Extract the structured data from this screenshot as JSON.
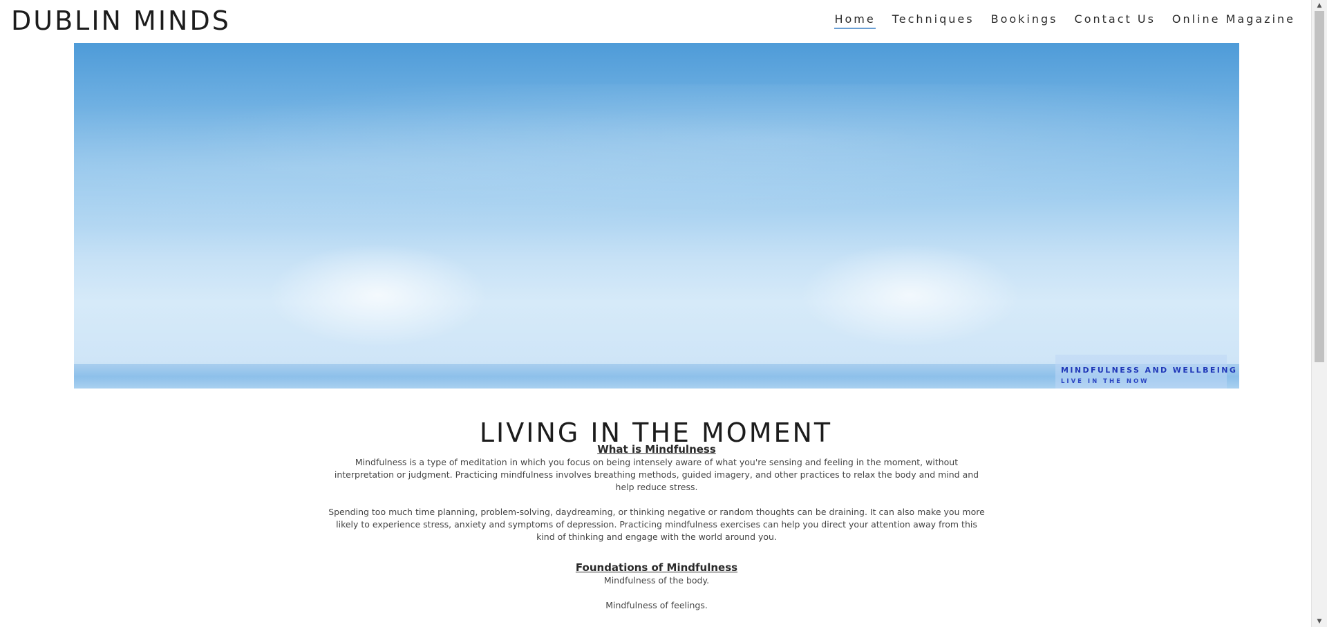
{
  "header": {
    "brand": "DUBLIN MINDS",
    "nav": [
      {
        "label": "Home",
        "active": true
      },
      {
        "label": "Techniques",
        "active": false
      },
      {
        "label": "Bookings",
        "active": false
      },
      {
        "label": "Contact Us",
        "active": false
      },
      {
        "label": "Online Magazine",
        "active": false
      }
    ],
    "active_underline_color": "#6a9fd4"
  },
  "hero": {
    "caption_title": "MINDFULNESS AND WELLBEING",
    "caption_subtitle": "LIVE IN THE NOW",
    "caption_color": "#1f37b8"
  },
  "main": {
    "title": "LIVING IN THE MOMENT",
    "sections": [
      {
        "heading": "What is Mindfulness",
        "paragraphs": [
          "Mindfulness is a type of meditation in which you focus on being intensely aware of what you're sensing and feeling in the moment, without interpretation or judgment. Practicing mindfulness involves breathing methods, guided imagery, and other practices to relax the body and mind and help reduce stress.",
          "Spending too much time planning, problem-solving, daydreaming, or thinking negative or random thoughts can be draining. It can also make you more likely to experience stress, anxiety and symptoms of depression. Practicing mindfulness exercises can help you direct your attention away from this kind of thinking and engage with the world around you."
        ]
      },
      {
        "heading": "Foundations of Mindfulness",
        "paragraphs": [
          "Mindfulness of the body.",
          "Mindfulness of feelings."
        ]
      }
    ]
  },
  "scrollbar": {
    "up_icon": "triangle-up",
    "down_icon": "triangle-down"
  }
}
